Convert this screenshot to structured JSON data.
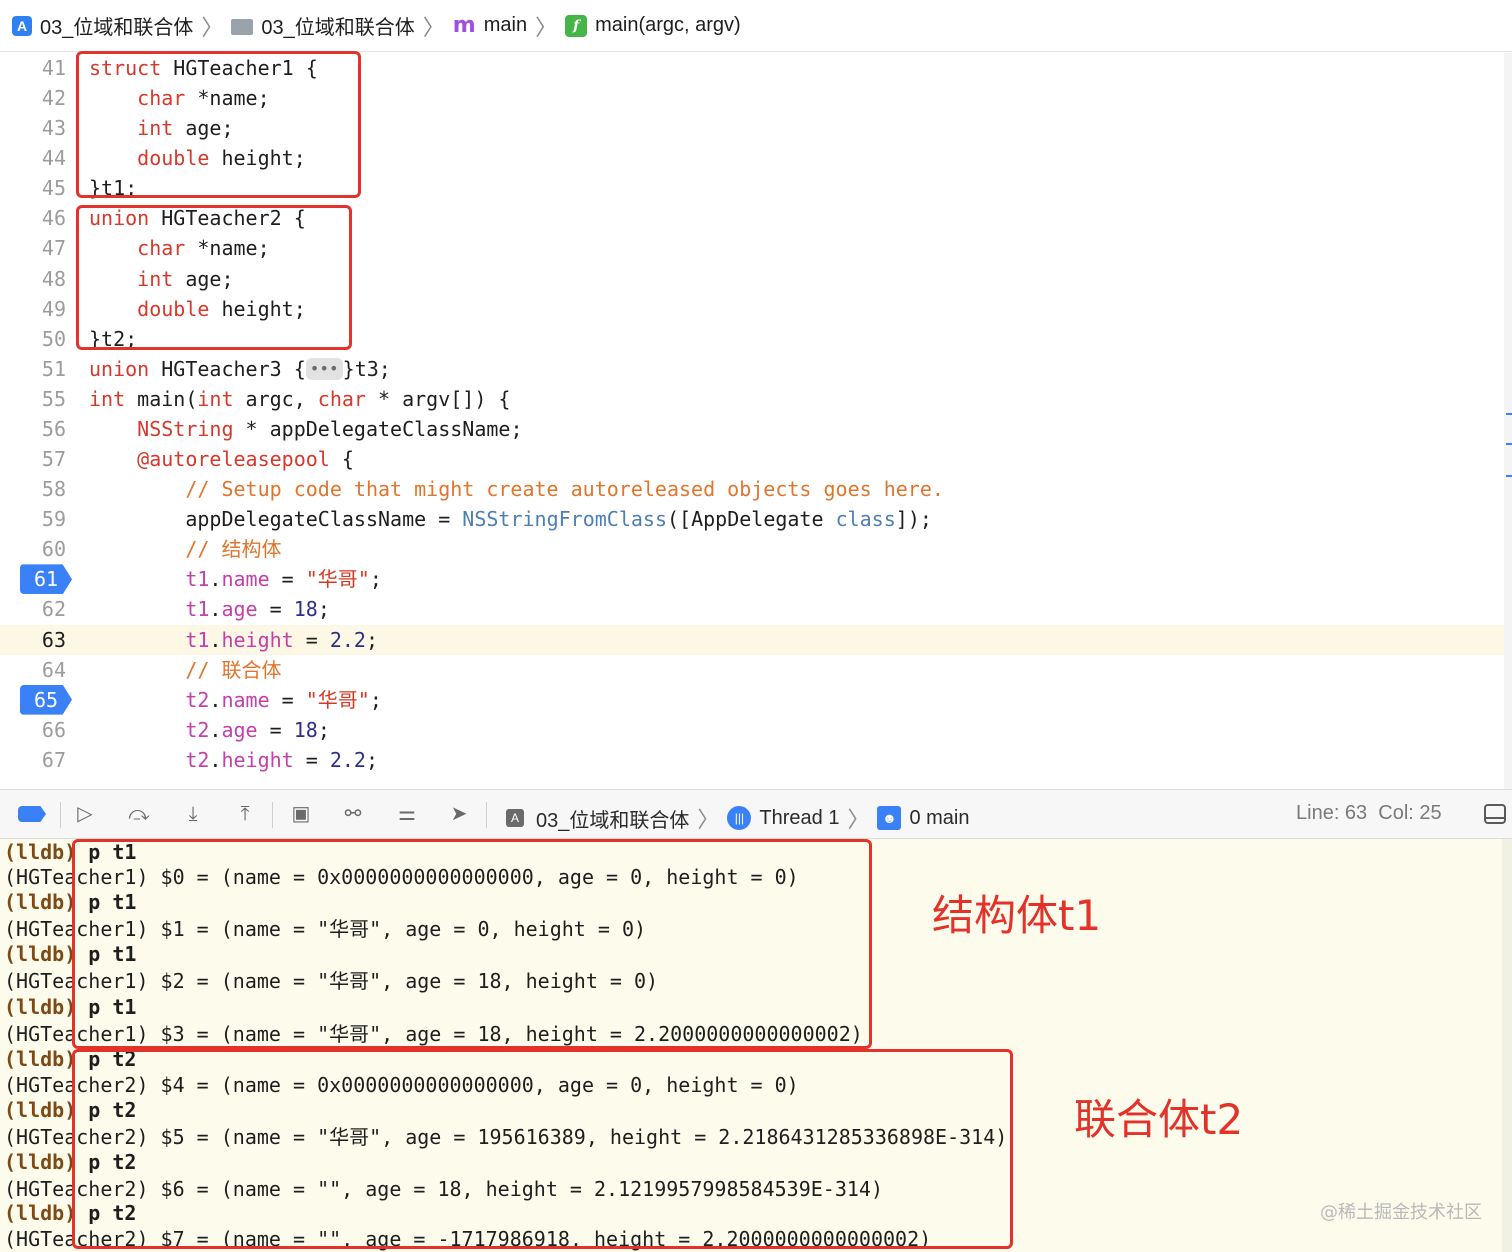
{
  "breadcrumb": {
    "project": "03_位域和联合体",
    "folder": "03_位域和联合体",
    "file": "main",
    "file_icon_glyph": "m",
    "function": "main(argc, argv)"
  },
  "editor": {
    "lines": [
      {
        "n": "41",
        "code": "<span class=\"kw\">struct</span> HGTeacher1 {"
      },
      {
        "n": "42",
        "code": "    <span class=\"ty\">char</span> *name;"
      },
      {
        "n": "43",
        "code": "    <span class=\"ty\">int</span> age;"
      },
      {
        "n": "44",
        "code": "    <span class=\"ty\">double</span> height;"
      },
      {
        "n": "45",
        "code": "}t1;"
      },
      {
        "n": "46",
        "code": "<span class=\"kw\">union</span> HGTeacher2 {"
      },
      {
        "n": "47",
        "code": "    <span class=\"ty\">char</span> *name;"
      },
      {
        "n": "48",
        "code": "    <span class=\"ty\">int</span> age;"
      },
      {
        "n": "49",
        "code": "    <span class=\"ty\">double</span> height;"
      },
      {
        "n": "50",
        "code": "}t2;"
      },
      {
        "n": "51",
        "code": "<span class=\"kw\">union</span> HGTeacher3 {<span class=\"fold\">•••</span>}t3;"
      },
      {
        "n": "55",
        "code": "<span class=\"ty\">int</span> main(<span class=\"ty\">int</span> argc, <span class=\"ty\">char</span> * argv[]) {"
      },
      {
        "n": "56",
        "code": "    <span class=\"ty\">NSString</span> * appDelegateClassName;"
      },
      {
        "n": "57",
        "code": "    <span class=\"kw\">@autoreleasepool</span> {"
      },
      {
        "n": "58",
        "code": "        <span class=\"cm\">// Setup code that might create autoreleased objects goes here.</span>"
      },
      {
        "n": "59",
        "code": "        appDelegateClassName = <span class=\"cls\">NSStringFromClass</span>([AppDelegate <span class=\"cls\">class</span>]);"
      },
      {
        "n": "60",
        "code": "        <span class=\"cm\">// 结构体</span>"
      },
      {
        "n": "61",
        "code": "        <span class=\"vr\">t1</span>.<span class=\"vr\">name</span> = <span class=\"str\">\"华哥\"</span>;",
        "bp": true
      },
      {
        "n": "62",
        "code": "        <span class=\"vr\">t1</span>.<span class=\"vr\">age</span> = <span class=\"num\">18</span>;"
      },
      {
        "n": "63",
        "code": "        <span class=\"vr\">t1</span>.<span class=\"vr\">height</span> = <span class=\"num\">2.2</span>;",
        "current": true
      },
      {
        "n": "64",
        "code": "        <span class=\"cm\">// 联合体</span>"
      },
      {
        "n": "65",
        "code": "        <span class=\"vr\">t2</span>.<span class=\"vr\">name</span> = <span class=\"str\">\"华哥\"</span>;",
        "bp": true
      },
      {
        "n": "66",
        "code": "        <span class=\"vr\">t2</span>.<span class=\"vr\">age</span> = <span class=\"num\">18</span>;"
      },
      {
        "n": "67",
        "code": "        <span class=\"vr\">t2</span>.<span class=\"vr\">height</span> = <span class=\"num\">2.2</span>;"
      }
    ]
  },
  "debug_bar": {
    "target": "03_位域和联合体",
    "thread": "Thread 1",
    "frame": "0 main",
    "line_col": "Line: 63  Col: 25",
    "accent": "#3a80f6"
  },
  "console": {
    "lines": [
      {
        "prompt": "(lldb)",
        "cmd": "p t1"
      },
      {
        "text": "(HGTeacher1) $0 = (name = 0x0000000000000000, age = 0, height = 0)"
      },
      {
        "prompt": "(lldb)",
        "cmd": "p t1"
      },
      {
        "text": "(HGTeacher1) $1 = (name = \"华哥\", age = 0, height = 0)"
      },
      {
        "prompt": "(lldb)",
        "cmd": "p t1"
      },
      {
        "text": "(HGTeacher1) $2 = (name = \"华哥\", age = 18, height = 0)"
      },
      {
        "prompt": "(lldb)",
        "cmd": "p t1"
      },
      {
        "text": "(HGTeacher1) $3 = (name = \"华哥\", age = 18, height = 2.2000000000000002)"
      },
      {
        "prompt": "(lldb)",
        "cmd": "p t2"
      },
      {
        "text": "(HGTeacher2) $4 = (name = 0x0000000000000000, age = 0, height = 0)"
      },
      {
        "prompt": "(lldb)",
        "cmd": "p t2"
      },
      {
        "text": "(HGTeacher2) $5 = (name = \"华哥\", age = 195616389, height = 2.2186431285336898E-314)"
      },
      {
        "prompt": "(lldb)",
        "cmd": "p t2"
      },
      {
        "text": "(HGTeacher2) $6 = (name = \"\", age = 18, height = 2.1219957998584539E-314)"
      },
      {
        "prompt": "(lldb)",
        "cmd": "p t2"
      },
      {
        "text": "(HGTeacher2) $7 = (name = \"\", age = -1717986918, height = 2.2000000000000002)"
      }
    ],
    "annotation_struct": "结构体t1",
    "annotation_union": "联合体t2",
    "watermark": "@稀土掘金技术社区",
    "annotation_color": "#e2322a"
  }
}
